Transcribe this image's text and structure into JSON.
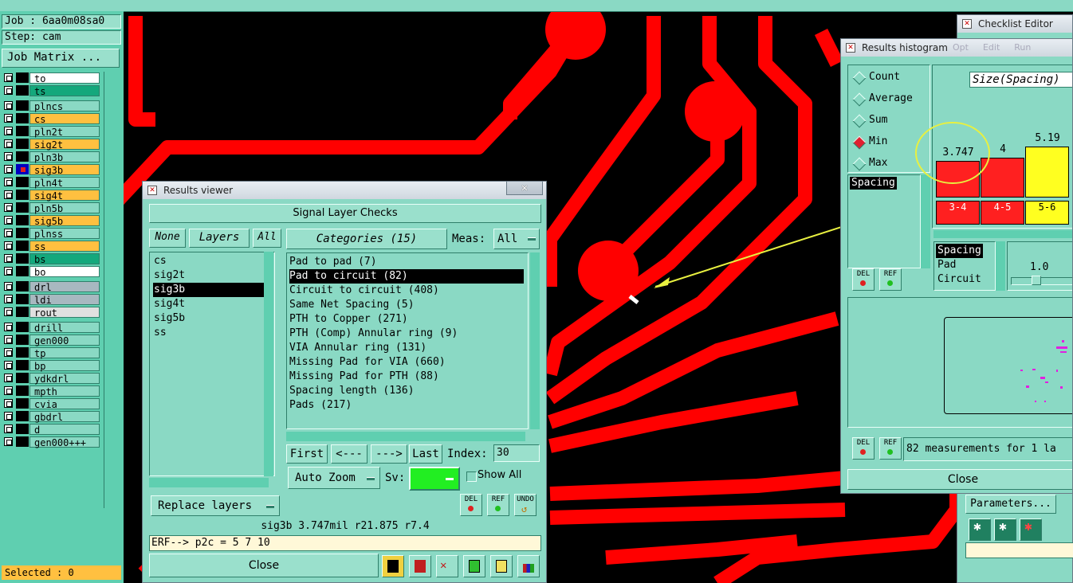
{
  "job_panel": {
    "job": "Job : 6aa0m08sa0",
    "step": "Step: cam",
    "job_matrix": "Job Matrix ...",
    "selected": "Selected : 0"
  },
  "layers": [
    {
      "name": "to",
      "color": "#ffffff"
    },
    {
      "name": "ts",
      "color": "#14a87c"
    },
    {
      "name": "plncs",
      "color": "#8ad9c4"
    },
    {
      "name": "cs",
      "color": "#ffc040"
    },
    {
      "name": "pln2t",
      "color": "#8ad9c4"
    },
    {
      "name": "sig2t",
      "color": "#ffc040"
    },
    {
      "name": "pln3b",
      "color": "#8ad9c4"
    },
    {
      "name": "sig3b",
      "color": "#ffc040"
    },
    {
      "name": "pln4t",
      "color": "#8ad9c4"
    },
    {
      "name": "sig4t",
      "color": "#ffc040"
    },
    {
      "name": "pln5b",
      "color": "#8ad9c4"
    },
    {
      "name": "sig5b",
      "color": "#ffc040"
    },
    {
      "name": "plnss",
      "color": "#8ad9c4"
    },
    {
      "name": "ss",
      "color": "#ffc040"
    },
    {
      "name": "bs",
      "color": "#14a87c"
    },
    {
      "name": "bo",
      "color": "#ffffff"
    },
    {
      "name": "drl",
      "color": "#a8b8c0"
    },
    {
      "name": "ldi",
      "color": "#a8b8c0"
    },
    {
      "name": "rout",
      "color": "#e0e0e0"
    },
    {
      "name": "drill",
      "color": "#8ad9c4"
    },
    {
      "name": "gen000",
      "color": "#8ad9c4"
    },
    {
      "name": "tp",
      "color": "#8ad9c4"
    },
    {
      "name": "bp",
      "color": "#8ad9c4"
    },
    {
      "name": "ydkdrl",
      "color": "#8ad9c4"
    },
    {
      "name": "mpth",
      "color": "#8ad9c4"
    },
    {
      "name": "cvia",
      "color": "#8ad9c4"
    },
    {
      "name": "gbdrl",
      "color": "#8ad9c4"
    },
    {
      "name": "d",
      "color": "#8ad9c4"
    },
    {
      "name": "gen000+++",
      "color": "#8ad9c4"
    }
  ],
  "results_viewer": {
    "title": "Results viewer",
    "header": "Signal Layer Checks",
    "none_btn": "None",
    "layers_btn": "Layers",
    "all_btn": "All",
    "categories_btn": "Categories (15)",
    "meas_label": "Meas:",
    "meas_value": "All",
    "layer_list": [
      "cs",
      "sig2t",
      "sig3b",
      "sig4t",
      "sig5b",
      "ss"
    ],
    "selected_layer": "sig3b",
    "categories": [
      "Pad to pad (7)",
      "Pad to circuit (82)",
      "Circuit to circuit (408)",
      "Same Net Spacing (5)",
      "PTH to Copper (271)",
      "PTH (Comp) Annular ring (9)",
      "VIA Annular ring (131)",
      "Missing Pad for VIA (660)",
      "Missing Pad for PTH (88)",
      "Spacing length (136)",
      "Pads (217)"
    ],
    "selected_category": "Pad to circuit (82)",
    "first": "First",
    "prev": "<---",
    "next": "--->",
    "last": "Last",
    "index_label": "Index:",
    "index_value": "30",
    "replace_layers": "Replace layers",
    "auto_zoom": "Auto Zoom",
    "sv_label": "Sv:",
    "show_all": "Show All",
    "del": "DEL",
    "ref": "REF",
    "undo": "UNDO",
    "status": "sig3b 3.747mil  r21.875  r7.4",
    "erf": "ERF--> p2c = 5 7 10",
    "close": "Close"
  },
  "histogram": {
    "title": "Results histogram",
    "menu": [
      "Opt",
      "Edit",
      "Run"
    ],
    "options": [
      "Count",
      "Average",
      "Sum",
      "Min",
      "Max"
    ],
    "selected_option": "Min",
    "list_top": [
      "Spacing"
    ],
    "list_bottom": [
      "Spacing",
      "Pad",
      "Circuit"
    ],
    "header": "Size(Spacing)",
    "bars": [
      {
        "label": "3.747",
        "range": "3-4",
        "color": "#ff2020",
        "value": 3.747
      },
      {
        "label": "4",
        "range": "4-5",
        "color": "#ff2020",
        "value": 4
      },
      {
        "label": "5.19",
        "range": "5-6",
        "color": "#ffff20",
        "value": 5.19
      }
    ],
    "slider_value": "1.0",
    "measurements": "82 measurements for 1 la",
    "del": "DEL",
    "ref": "REF",
    "close": "Close"
  },
  "checklist": {
    "title": "Checklist Editor",
    "parameters": "Parameters..."
  }
}
